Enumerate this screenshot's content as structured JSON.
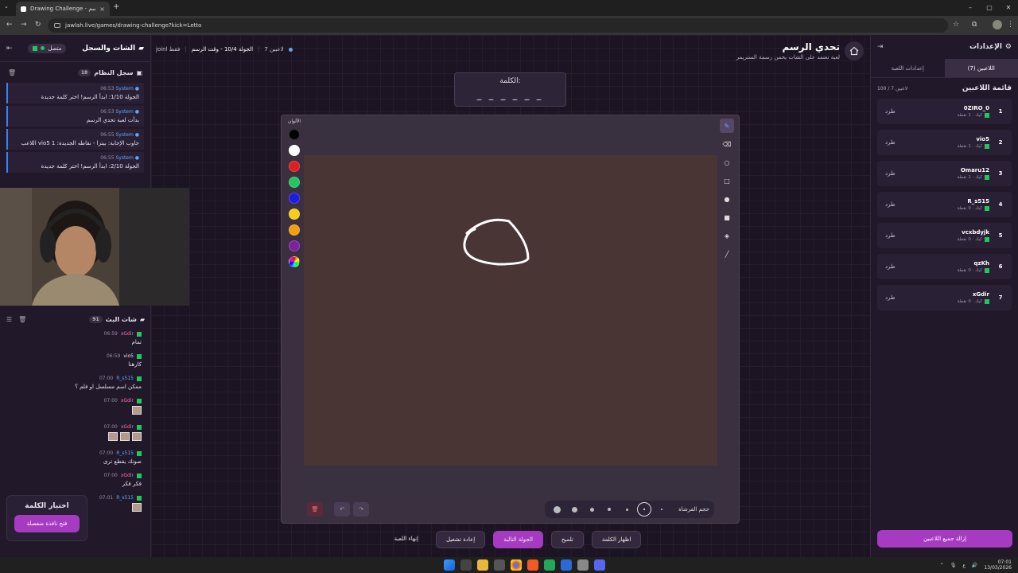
{
  "browser": {
    "tab_title": "Drawing Challenge - تحدي الرسم",
    "url": "jawlah.live/games/drawing-challenge?kick=Letto"
  },
  "left_panel": {
    "title": "الشات والسجل",
    "status": "متصل",
    "system_log_title": "سجل النظام",
    "system_log_count": "18",
    "system_messages": [
      {
        "time": "06:53",
        "sender": "System",
        "text": "الجولة 1/10: ابدأ الرسم! اختر كلمة جديدة"
      },
      {
        "time": "06:53",
        "sender": "System",
        "text": "بدأت لعبة تحدي الرسم"
      },
      {
        "time": "06:55",
        "sender": "System",
        "text": "اللاعب vio5 جاوب الإجابة: بيتزا - نقاطه الجديدة: 1"
      },
      {
        "time": "06:55",
        "sender": "System",
        "text": "الجولة 2/10: ابدأ الرسم! اختر كلمة جديدة"
      }
    ],
    "chat_title": "شات البث",
    "chat_count": "91",
    "chat_messages": [
      {
        "time": "06:59",
        "user": "xGdir",
        "text": "تمام",
        "thumbs": 0,
        "style": "a"
      },
      {
        "time": "06:59",
        "user": "vio5",
        "text": "كارهنا",
        "thumbs": 0,
        "style": "b"
      },
      {
        "time": "07:00",
        "user": "R_s515",
        "text": "ممكن اسم مسلسل او فلم ؟",
        "thumbs": 0,
        "style": "c"
      },
      {
        "time": "07:00",
        "user": "xGdir",
        "text": "",
        "thumbs": 1,
        "style": "a"
      },
      {
        "time": "07:00",
        "user": "xGdir",
        "text": "",
        "thumbs": 3,
        "style": "a"
      },
      {
        "time": "07:00",
        "user": "R_s515",
        "text": "صوتك يقطع ترى",
        "thumbs": 0,
        "style": "c"
      },
      {
        "time": "07:00",
        "user": "xGdir",
        "text": "فكر فكر",
        "thumbs": 0,
        "style": "a"
      },
      {
        "time": "07:01",
        "user": "R_s515",
        "text": "",
        "thumbs": 1,
        "style": "c"
      }
    ],
    "word_choice_title": "اختيار الكلمة",
    "word_choice_button": "فتح نافذة منفصلة"
  },
  "header": {
    "players": "7 لاعبين",
    "round": "الجولة 10/4 - وقت الرسم",
    "mode": "joinl فقط",
    "title": "تحدي الرسم",
    "subtitle": "لعبة تعتمد على الشات يخمن رسمة الستريمر"
  },
  "word_box": {
    "label": "الكلمة:",
    "dashes": "_ _ _ _ _ _"
  },
  "board": {
    "colors_label": "الألوان",
    "colors": [
      "#000000",
      "#ffffff",
      "#e11d1d",
      "#22c55e",
      "#1d1de0",
      "#facc15",
      "#f59e0b",
      "#7e1fa0"
    ],
    "brush_size_label": "حجم الفرشاة",
    "canvas_color": "#4a3535",
    "tools": [
      "pen-icon",
      "eraser-icon",
      "circle-icon",
      "square-icon",
      "filled-circle-icon",
      "filled-square-icon",
      "fill-icon",
      "line-icon"
    ]
  },
  "controls": {
    "end_game": "إنهاء اللعبة",
    "restart": "إعادة تشغيل",
    "next_round": "الجولة التالية",
    "hint": "تلميح",
    "show_word": "اظهار الكلمة"
  },
  "right_panel": {
    "title": "الإعدادات",
    "tab_players": "اللاعبين (7)",
    "tab_settings": "إعدادات اللعبة",
    "list_title": "قائمة اللاعبين",
    "list_count": "100 / 7 لاعبين",
    "kick_label": "طرد",
    "players": [
      {
        "rank": "1",
        "name": "0ZIRO_0",
        "stat": "كيك · 1 نقطة"
      },
      {
        "rank": "2",
        "name": "vio5",
        "stat": "كيك · 1 نقطة"
      },
      {
        "rank": "3",
        "name": "Omaru12",
        "stat": "كيك · 1 نقطة"
      },
      {
        "rank": "4",
        "name": "R_s515",
        "stat": "كيك · 0 نقطة"
      },
      {
        "rank": "5",
        "name": "vcxbdyjk",
        "stat": "كيك · 0 نقطة"
      },
      {
        "rank": "6",
        "name": "qzKh",
        "stat": "كيك · 0 نقطة"
      },
      {
        "rank": "7",
        "name": "xGdir",
        "stat": "كيك · 0 نقطة"
      }
    ],
    "remove_all": "إزالة جميع اللاعبين"
  },
  "taskbar": {
    "time": "07:01",
    "date": "13/03/2026"
  }
}
